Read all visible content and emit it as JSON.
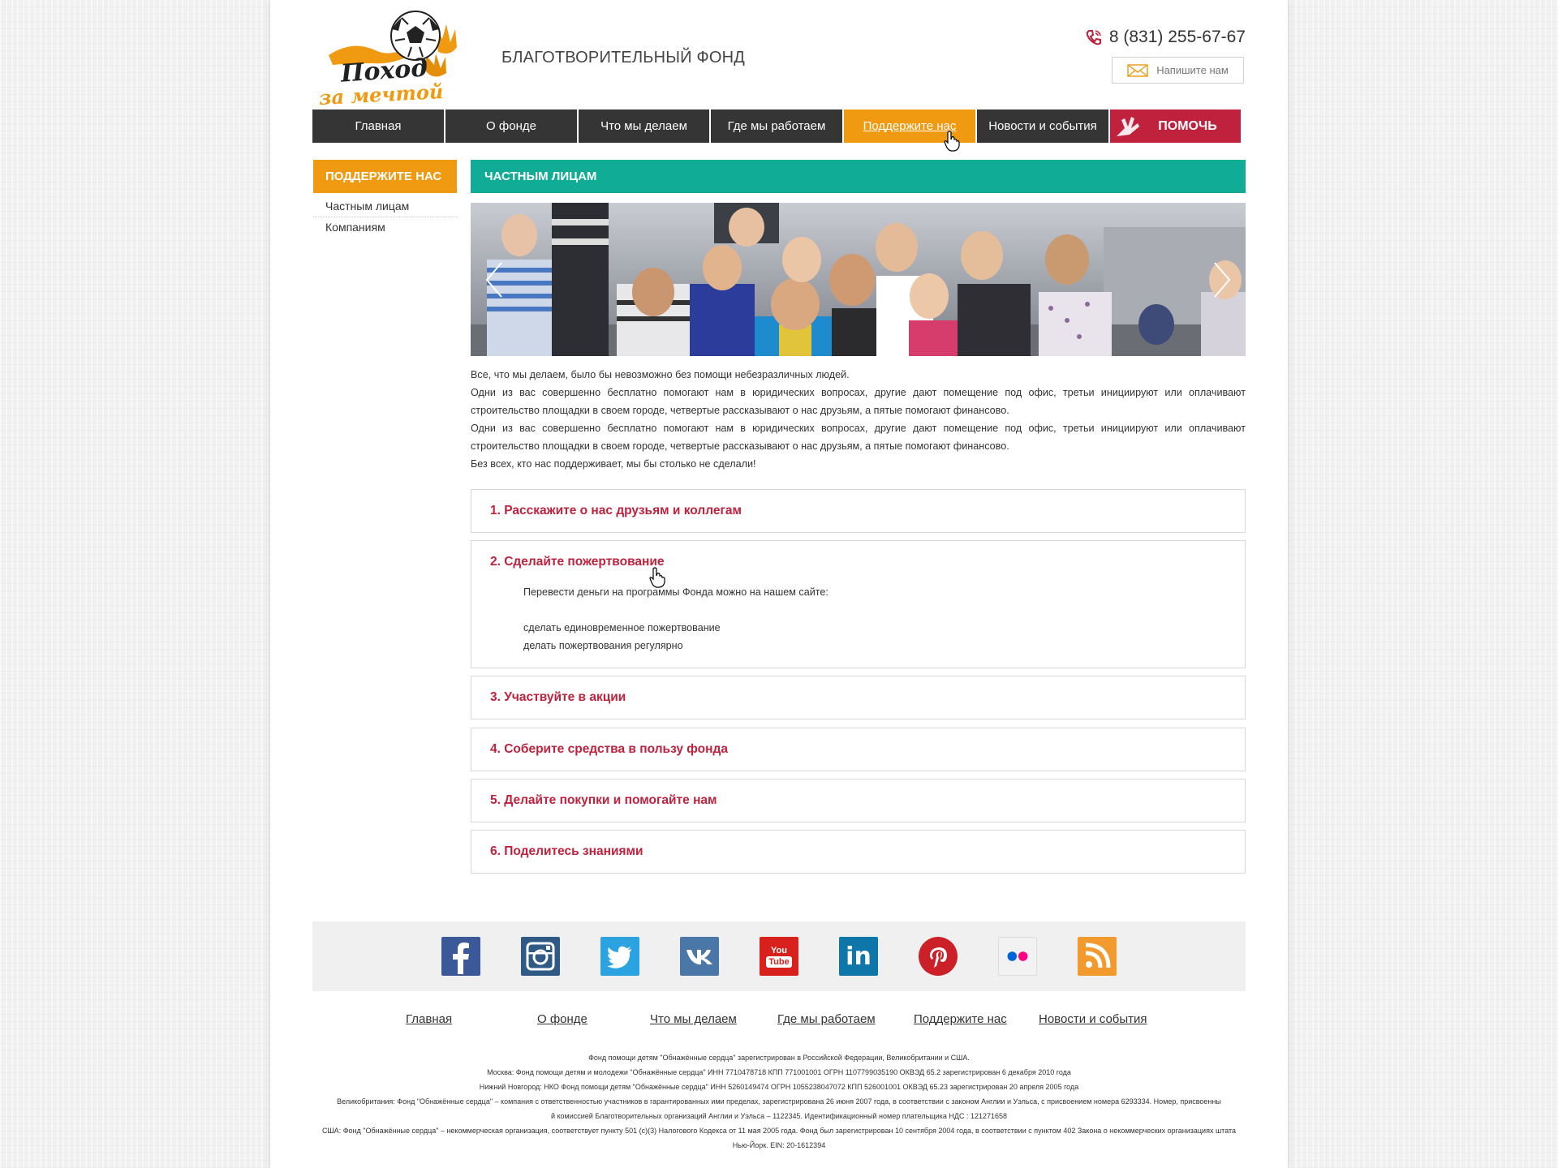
{
  "header": {
    "logo_line1": "Поход",
    "logo_line2": "за мечтой",
    "tagline": "БЛАГОТВОРИТЕЛЬНЫЙ ФОНД",
    "phone": "8 (831) 255-67-67",
    "write_us": "Напишите нам"
  },
  "nav": {
    "items": [
      {
        "label": "Главная"
      },
      {
        "label": "О фонде"
      },
      {
        "label": "Что мы делаем"
      },
      {
        "label": "Где мы работаем"
      },
      {
        "label": "Поддержите нас"
      },
      {
        "label": "Новости и события"
      }
    ],
    "help": "ПОМОЧЬ"
  },
  "sidebar": {
    "title": "ПОДДЕРЖИТЕ НАС",
    "items": [
      {
        "label": "Частным лицам"
      },
      {
        "label": "Компаниям"
      }
    ]
  },
  "main": {
    "title": "ЧАСТНЫМ ЛИЦАМ",
    "intro": [
      "Все, что мы делаем, было бы невозможно без помощи небезразличных людей.",
      "Одни из вас совершенно бесплатно помогают нам в юридических вопросах, другие дают помещение под офис, третьи инициируют или оплачивают строительство площадки в своем городе, четвертые рассказывают о нас друзьям, а пятые помогают финансово.",
      "Одни из вас совершенно бесплатно помогают нам в юридических вопросах, другие дают помещение под офис, третьи инициируют или оплачивают строительство площадки в своем городе, четвертые рассказывают о нас друзьям, а пятые помогают финансово.",
      "Без всех, кто нас поддерживает, мы бы столько не сделали!"
    ],
    "accordion": [
      {
        "title": "1. Расскажите о нас друзьям и коллегам"
      },
      {
        "title": "2. Сделайте пожертвование",
        "body_intro": "Перевести деньги на программы Фонда можно на нашем сайте:",
        "body_line1": "сделать единовременное пожертвование",
        "body_line2": "делать пожертвования регулярно"
      },
      {
        "title": "3. Участвуйте в акции"
      },
      {
        "title": "4. Соберите средства в пользу фонда"
      },
      {
        "title": "5. Делайте покупки и помогайте нам"
      },
      {
        "title": "6. Поделитесь знаниями"
      }
    ]
  },
  "social": [
    {
      "icon": "facebook-icon",
      "color": "#3b5998"
    },
    {
      "icon": "instagram-icon",
      "color": "#2e5a85"
    },
    {
      "icon": "twitter-icon",
      "color": "#2aa3e0"
    },
    {
      "icon": "vk-icon",
      "color": "#4a76a8"
    },
    {
      "icon": "youtube-icon",
      "color": "#d8201c",
      "text_top": "You",
      "text_bottom": "Tube"
    },
    {
      "icon": "linkedin-icon",
      "color": "#0e76a8",
      "text": "in"
    },
    {
      "icon": "pinterest-icon",
      "color": "#cb2027"
    },
    {
      "icon": "flickr-icon",
      "color": "#f2f2f2"
    },
    {
      "icon": "rss-icon",
      "color": "#f39a2f"
    }
  ],
  "footer_nav": [
    {
      "label": "Главная"
    },
    {
      "label": "О фонде"
    },
    {
      "label": "Что мы делаем"
    },
    {
      "label": "Где мы работаем"
    },
    {
      "label": "Поддержите нас"
    },
    {
      "label": "Новости и события"
    }
  ],
  "legal": [
    "Фонд помощи детям \"Обнажённые сердца\" зарегистрирован в Российской Федерации, Великобритании и США.",
    "Москва: Фонд помощи детям и молодежи \"Обнажённые сердца\" ИНН 7710478718 КПП 771001001 ОГРН 1107799035190 ОКВЭД 65.2 зарегистрирован 6 декабря 2010 года",
    "Нижний Новгород: НКО Фонд помощи детям \"Обнажённые сердца\" ИНН 5260149474 ОГРН 1055238047072 КПП 526001001 ОКВЭД 65.23 зарегистрирован 20 апреля 2005 года",
    "Великобритания: Фонд \"Обнажённые сердца\" – компания с ответственностью участников в гарантированных ими пределах, зарегистрирована 26 июня 2007 года, в соответствии с законом Англии и Уэльса, с присвоением номера 6293334. Номер, присвоенны",
    "й комиссией Благотворительных организаций Англии и Уэльса – 1122345. Идентификационный номер плательщика НДС : 121271658",
    "США: Фонд \"Обнажённые сердца\" – некоммерческая организация, соответствует пункту 501 (c)(3) Налогового Кодекса от 11 мая 2005 года. Фонд был зарегистрирован 10 сентября 2004 года, в соответствии с пунктом 402 Закона о некоммерческих организациях штата",
    "Нью-Йорк. EIN: 20-1612394"
  ]
}
